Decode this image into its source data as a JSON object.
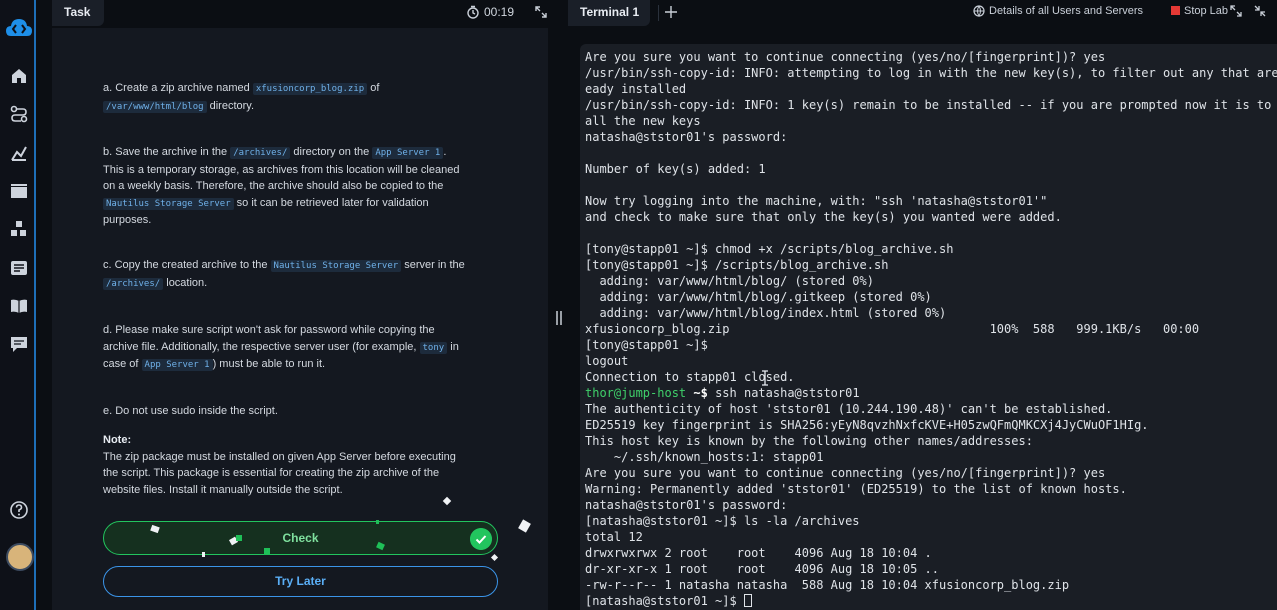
{
  "task_panel": {
    "tab_label": "Task",
    "timer": "00:19",
    "paragraphs": {
      "a": {
        "pre": "a. Create a zip archive named ",
        "code1": "xfusioncorp_blog.zip",
        "mid": " of",
        "code2": "/var/www/html/blog",
        "post": " directory."
      },
      "b": {
        "pre": "b. Save the archive in the ",
        "code1": "/archives/",
        "mid": " directory on the ",
        "code2": "App Server 1",
        "post": ".",
        "line2": "This is a temporary storage, as archives from this location will be cleaned",
        "line3": "on a weekly basis. Therefore, the archive should also be copied to the",
        "code3": "Nautilus Storage Server",
        "post3": " so it can be retrieved later for validation",
        "line5": "purposes."
      },
      "c": {
        "pre": "c. Copy the created archive to the ",
        "code1": "Nautilus Storage Server",
        "mid": " server in the",
        "code2": "/archives/",
        "post": " location."
      },
      "d": {
        "line1": "d. Please make sure script won't ask for password while copying the",
        "line2pre": "archive file. Additionally, the respective server user (for example, ",
        "code1": "tony",
        "post2": " in",
        "line3pre": "case of ",
        "code2": "App Server 1",
        "post3": ") must be able to run it."
      },
      "e": {
        "text": "e. Do not use sudo inside the script."
      },
      "note": {
        "title": "Note:",
        "line1": "The zip package must be installed on given App Server before executing",
        "line2": "the script. This package is essential for creating the zip archive of the",
        "line3": "website files. Install it manually outside the script."
      }
    },
    "check_button": "Check",
    "try_later_button": "Try Later"
  },
  "terminal_panel": {
    "tab_label": "Terminal 1",
    "details_link": "Details of all Users and Servers",
    "stop_lab": "Stop Lab",
    "lines": [
      "Are you sure you want to continue connecting (yes/no/[fingerprint])? yes",
      "/usr/bin/ssh-copy-id: INFO: attempting to log in with the new key(s), to filter out any that are al",
      "eady installed",
      "/usr/bin/ssh-copy-id: INFO: 1 key(s) remain to be installed -- if you are prompted now it is to ins",
      "all the new keys",
      "natasha@ststor01's password:",
      "",
      "Number of key(s) added: 1",
      "",
      "Now try logging into the machine, with: \"ssh 'natasha@ststor01'\"",
      "and check to make sure that only the key(s) you wanted were added.",
      "",
      "[tony@stapp01 ~]$ chmod +x /scripts/blog_archive.sh",
      "[tony@stapp01 ~]$ /scripts/blog_archive.sh",
      "  adding: var/www/html/blog/ (stored 0%)",
      "  adding: var/www/html/blog/.gitkeep (stored 0%)",
      "  adding: var/www/html/blog/index.html (stored 0%)",
      "xfusioncorp_blog.zip                                    100%  588   999.1KB/s   00:00",
      "[tony@stapp01 ~]$",
      "logout",
      "Connection to stapp01 closed.",
      "__PROMPT__",
      "The authenticity of host 'ststor01 (10.244.190.48)' can't be established.",
      "ED25519 key fingerprint is SHA256:yEyN8qvzhNxfcKVE+H05zwQFmQMKCXj4JyCWuOF1HIg.",
      "This host key is known by the following other names/addresses:",
      "    ~/.ssh/known_hosts:1: stapp01",
      "Are you sure you want to continue connecting (yes/no/[fingerprint])? yes",
      "Warning: Permanently added 'ststor01' (ED25519) to the list of known hosts.",
      "natasha@ststor01's password:",
      "[natasha@ststor01 ~]$ ls -la /archives",
      "total 12",
      "drwxrwxrwx 2 root    root    4096 Aug 18 10:04 .",
      "dr-xr-xr-x 1 root    root    4096 Aug 18 10:05 ..",
      "-rw-r--r-- 1 natasha natasha  588 Aug 18 10:04 xfusioncorp_blog.zip",
      "[natasha@ststor01 ~]$ "
    ],
    "jump_prompt": {
      "user_host": "thor@jump-host",
      "path": " ~$",
      "command": " ssh natasha@ststor01"
    }
  },
  "colors": {
    "accent": "#1e6fb8",
    "success": "#22c55e",
    "link": "#3b94e8",
    "stop": "#e53935",
    "prompt": "#3fd06a"
  },
  "icons": [
    "logo-icon",
    "home-icon",
    "route-icon",
    "chart-icon",
    "video-icon",
    "blocks-icon",
    "news-icon",
    "book-icon",
    "chat-icon",
    "help-icon",
    "timer-icon",
    "expand-icon",
    "plus-icon",
    "details-icon",
    "stop-icon"
  ]
}
